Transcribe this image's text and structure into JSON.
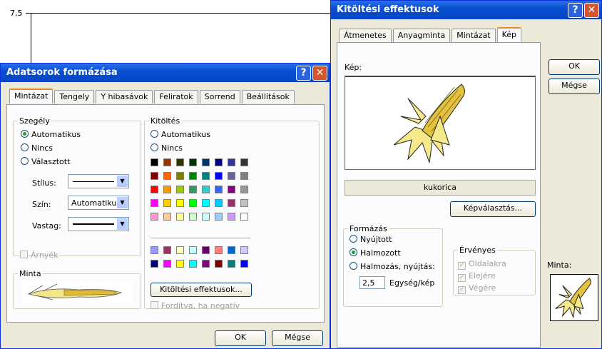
{
  "chart": {
    "y_tick": "7,5"
  },
  "dialog1": {
    "title": "Adatsorok formázása",
    "tabs": [
      "Mintázat",
      "Tengely",
      "Y hibasávok",
      "Feliratok",
      "Sorrend",
      "Beállítások"
    ],
    "border": {
      "label": "Szegély",
      "opt_auto": "Automatikus",
      "opt_none": "Nincs",
      "opt_custom": "Választott",
      "style_label": "Stílus:",
      "color_label": "Szín:",
      "color_value": "Automatikus",
      "weight_label": "Vastag:",
      "shadow": "Árnyék"
    },
    "fill": {
      "label": "Kitöltés",
      "opt_auto": "Automatikus",
      "opt_none": "Nincs",
      "effects_btn": "Kitöltési effektusok...",
      "invert": "Fordítva, ha negatív"
    },
    "sample_label": "Minta",
    "ok": "OK",
    "cancel": "Mégse",
    "palette_top": [
      [
        "#000000",
        "#993300",
        "#333300",
        "#003300",
        "#003366",
        "#000080",
        "#333399",
        "#333333"
      ],
      [
        "#800000",
        "#ff6600",
        "#808000",
        "#008000",
        "#008080",
        "#0000ff",
        "#666699",
        "#808080"
      ],
      [
        "#ff0000",
        "#ff9900",
        "#99cc00",
        "#339966",
        "#33cccc",
        "#3366ff",
        "#800080",
        "#969696"
      ],
      [
        "#ff00ff",
        "#ffcc00",
        "#ffff00",
        "#00ff00",
        "#00ffff",
        "#00ccff",
        "#993366",
        "#c0c0c0"
      ],
      [
        "#ff99cc",
        "#ffcc99",
        "#ffff99",
        "#ccffcc",
        "#ccffff",
        "#99ccff",
        "#cc99ff",
        "#ffffff"
      ]
    ],
    "palette_bottom": [
      [
        "#9999ff",
        "#993366",
        "#ffffcc",
        "#ccffff",
        "#660066",
        "#ff8080",
        "#0066cc",
        "#ccccff"
      ],
      [
        "#000080",
        "#ff00ff",
        "#ffff00",
        "#00ffff",
        "#800080",
        "#800000",
        "#008080",
        "#0000ff"
      ]
    ]
  },
  "dialog2": {
    "title": "Kitöltési effektusok",
    "tabs": [
      "Átmenetes",
      "Anyagminta",
      "Mintázat",
      "Kép"
    ],
    "picture_label": "Kép:",
    "picture_name": "kukorica",
    "select_btn": "Képválasztás...",
    "format": {
      "label": "Formázás",
      "opt_stretch": "Nyújtott",
      "opt_stack": "Halmozott",
      "opt_stack_scale": "Halmozás, nyújtás:",
      "units_value": "2,5",
      "units_label": "Egység/kép"
    },
    "apply": {
      "label": "Érvényes",
      "sides": "Oldalakra",
      "front": "Elejére",
      "end": "Végére"
    },
    "ok": "OK",
    "cancel": "Mégse",
    "sample_label": "Minta:"
  }
}
